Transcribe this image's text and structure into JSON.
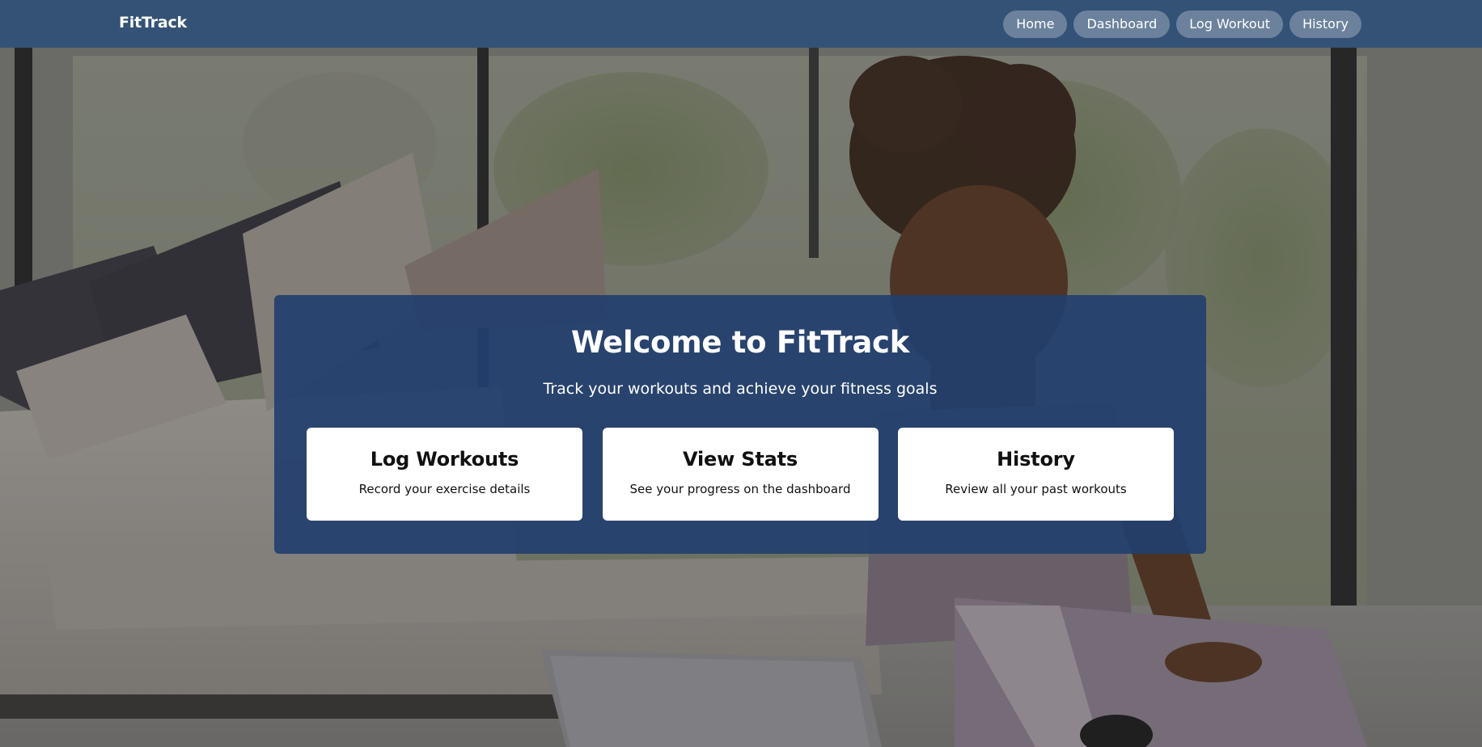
{
  "navbar": {
    "brand": "FitTrack",
    "links": [
      {
        "label": "Home"
      },
      {
        "label": "Dashboard"
      },
      {
        "label": "Log Workout"
      },
      {
        "label": "History"
      }
    ]
  },
  "hero": {
    "title": "Welcome to FitTrack",
    "subtitle": "Track your workouts and achieve your fitness goals",
    "cards": [
      {
        "title": "Log Workouts",
        "description": "Record your exercise details"
      },
      {
        "title": "View Stats",
        "description": "See your progress on the dashboard"
      },
      {
        "title": "History",
        "description": "Review all your past workouts"
      }
    ]
  },
  "colors": {
    "navbar_bg": "#345276",
    "panel_bg": "#22406e",
    "card_bg": "#ffffff",
    "nav_pill_bg": "#7a8aa0"
  }
}
